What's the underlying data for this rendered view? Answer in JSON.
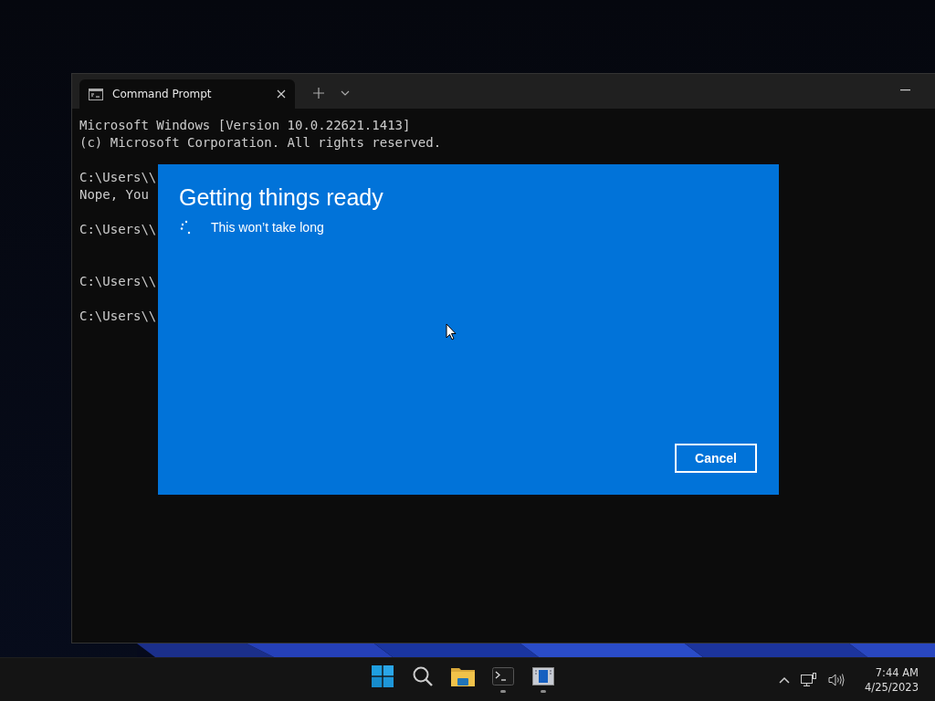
{
  "terminal": {
    "tabs": [
      {
        "title": "Command Prompt",
        "selected": true
      }
    ],
    "blocks": [
      {
        "wide_gap": false,
        "lines": [
          "Microsoft Windows [Version 10.0.22621.1413]",
          "(c) Microsoft Corporation. All rights reserved."
        ]
      },
      {
        "wide_gap": false,
        "lines": [
          "C:\\Users\\\\",
          "Nope, You"
        ]
      },
      {
        "wide_gap": false,
        "lines": [
          "C:\\Users\\\\"
        ]
      },
      {
        "wide_gap": true,
        "lines": [
          "C:\\Users\\\\"
        ]
      },
      {
        "wide_gap": false,
        "lines": [
          "C:\\Users\\\\"
        ]
      }
    ]
  },
  "dialog": {
    "title": "Getting things ready",
    "message": "This won’t take long",
    "button": "Cancel"
  },
  "taskbar": {
    "apps": [
      {
        "kind": "start",
        "running": false
      },
      {
        "kind": "search",
        "running": false
      },
      {
        "kind": "explorer",
        "running": false
      },
      {
        "kind": "terminal",
        "running": true
      },
      {
        "kind": "app",
        "running": true
      }
    ],
    "time": "7:44 AM",
    "date": "4/25/2023"
  }
}
